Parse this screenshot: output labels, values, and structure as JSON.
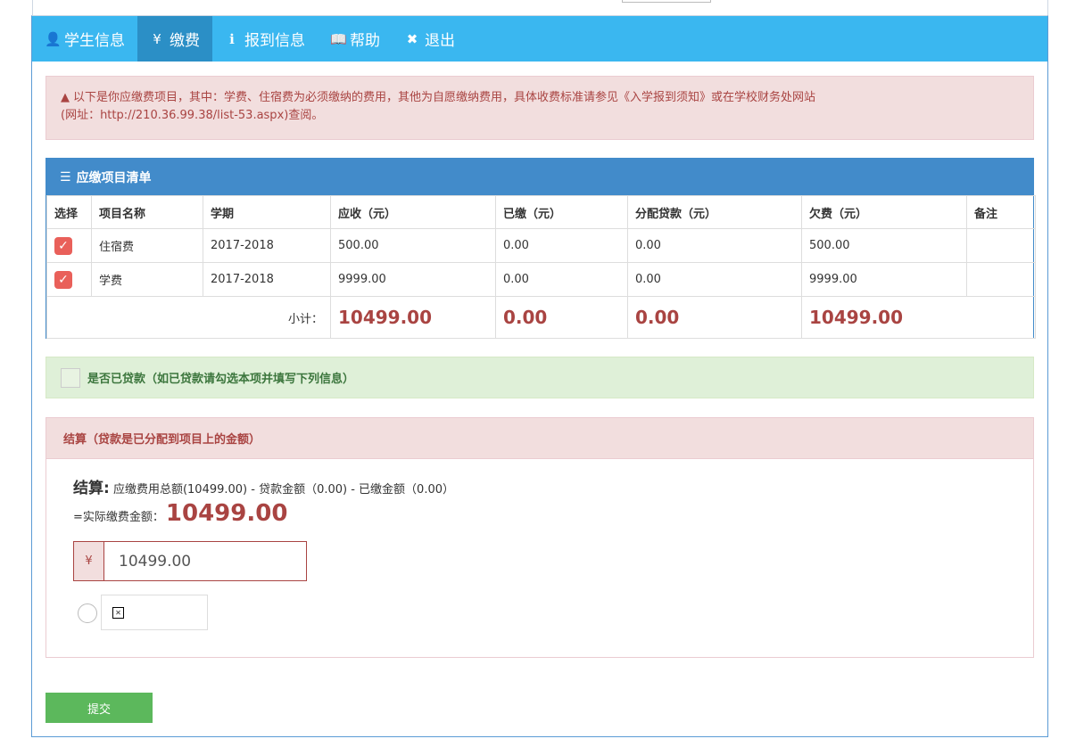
{
  "nav": {
    "items": [
      {
        "icon": "user-icon",
        "glyph": "👤",
        "label": "学生信息",
        "active": false
      },
      {
        "icon": "yen-icon",
        "glyph": "¥",
        "label": "缴费",
        "active": true
      },
      {
        "icon": "info-icon",
        "glyph": "ℹ",
        "label": "报到信息",
        "active": false
      },
      {
        "icon": "book-icon",
        "glyph": "📖",
        "label": "帮助",
        "active": false
      },
      {
        "icon": "close-icon",
        "glyph": "✖",
        "label": "退出",
        "active": false
      }
    ]
  },
  "alert": {
    "line1": "以下是你应缴费项目，其中：学费、住宿费为必须缴纳的费用，其他为自愿缴纳费用，具体收费标准请参见《入学报到须知》或在学校财务处网站",
    "line2": "(网址：http://210.36.99.38/list-53.aspx)查阅。"
  },
  "list_panel": {
    "title": "应缴项目清单",
    "headers": [
      "选择",
      "项目名称",
      "学期",
      "应收（元）",
      "已缴（元）",
      "分配贷款（元）",
      "欠费（元）",
      "备注"
    ],
    "rows": [
      {
        "checked": true,
        "name": "住宿费",
        "term": "2017-2018",
        "receivable": "500.00",
        "paid": "0.00",
        "loan": "0.00",
        "owed": "500.00",
        "note": ""
      },
      {
        "checked": true,
        "name": "学费",
        "term": "2017-2018",
        "receivable": "9999.00",
        "paid": "0.00",
        "loan": "0.00",
        "owed": "9999.00",
        "note": ""
      }
    ],
    "subtotal": {
      "label": "小计：",
      "receivable": "10499.00",
      "paid": "0.00",
      "loan": "0.00",
      "owed": "10499.00"
    }
  },
  "loan_option": {
    "label": "是否已贷款（如已贷款请勾选本项并填写下列信息）",
    "checked": false
  },
  "settlement": {
    "title": "结算（贷款是已分配到项目上的金额）",
    "calc_label": "结算:",
    "calc_text": "应缴费用总额(10499.00) - 贷款金额（0.00) - 已缴金额（0.00）",
    "actual_label": "=实际缴费金额：",
    "actual_amount": "10499.00",
    "currency_symbol": "¥",
    "amount_value": "10499.00"
  },
  "submit_label": "提交",
  "colors": {
    "nav_bg": "#3ab7f0",
    "nav_active": "#2b8fc6",
    "accent_red": "#a94442",
    "success": "#5cb85c",
    "primary": "#428bca"
  }
}
